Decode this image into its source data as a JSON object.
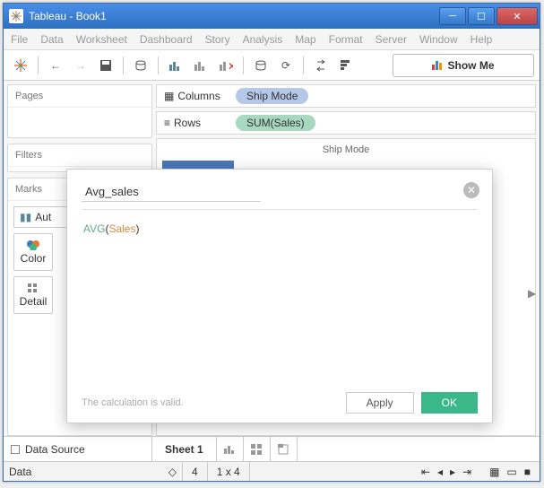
{
  "window": {
    "title": "Tableau - Book1"
  },
  "menu": [
    "File",
    "Data",
    "Worksheet",
    "Dashboard",
    "Story",
    "Analysis",
    "Map",
    "Format",
    "Server",
    "Window",
    "Help"
  ],
  "showme": "Show Me",
  "shelves": {
    "columns_label": "Columns",
    "rows_label": "Rows",
    "columns_pill": "Ship Mode",
    "rows_pill": "SUM(Sales)"
  },
  "panels": {
    "pages": "Pages",
    "filters": "Filters",
    "marks": "Marks",
    "marktype": "Aut",
    "color": "Color",
    "detail": "Detail"
  },
  "viz": {
    "header": "Ship Mode"
  },
  "calc": {
    "name": "Avg_sales",
    "formula_fn": "AVG",
    "formula_field": "Sales",
    "status": "The calculation is valid.",
    "apply": "Apply",
    "ok": "OK"
  },
  "tabs": {
    "datasource": "Data Source",
    "sheet": "Sheet 1"
  },
  "status": {
    "field": "Data",
    "marks": "4",
    "dims": "1 x 4"
  }
}
